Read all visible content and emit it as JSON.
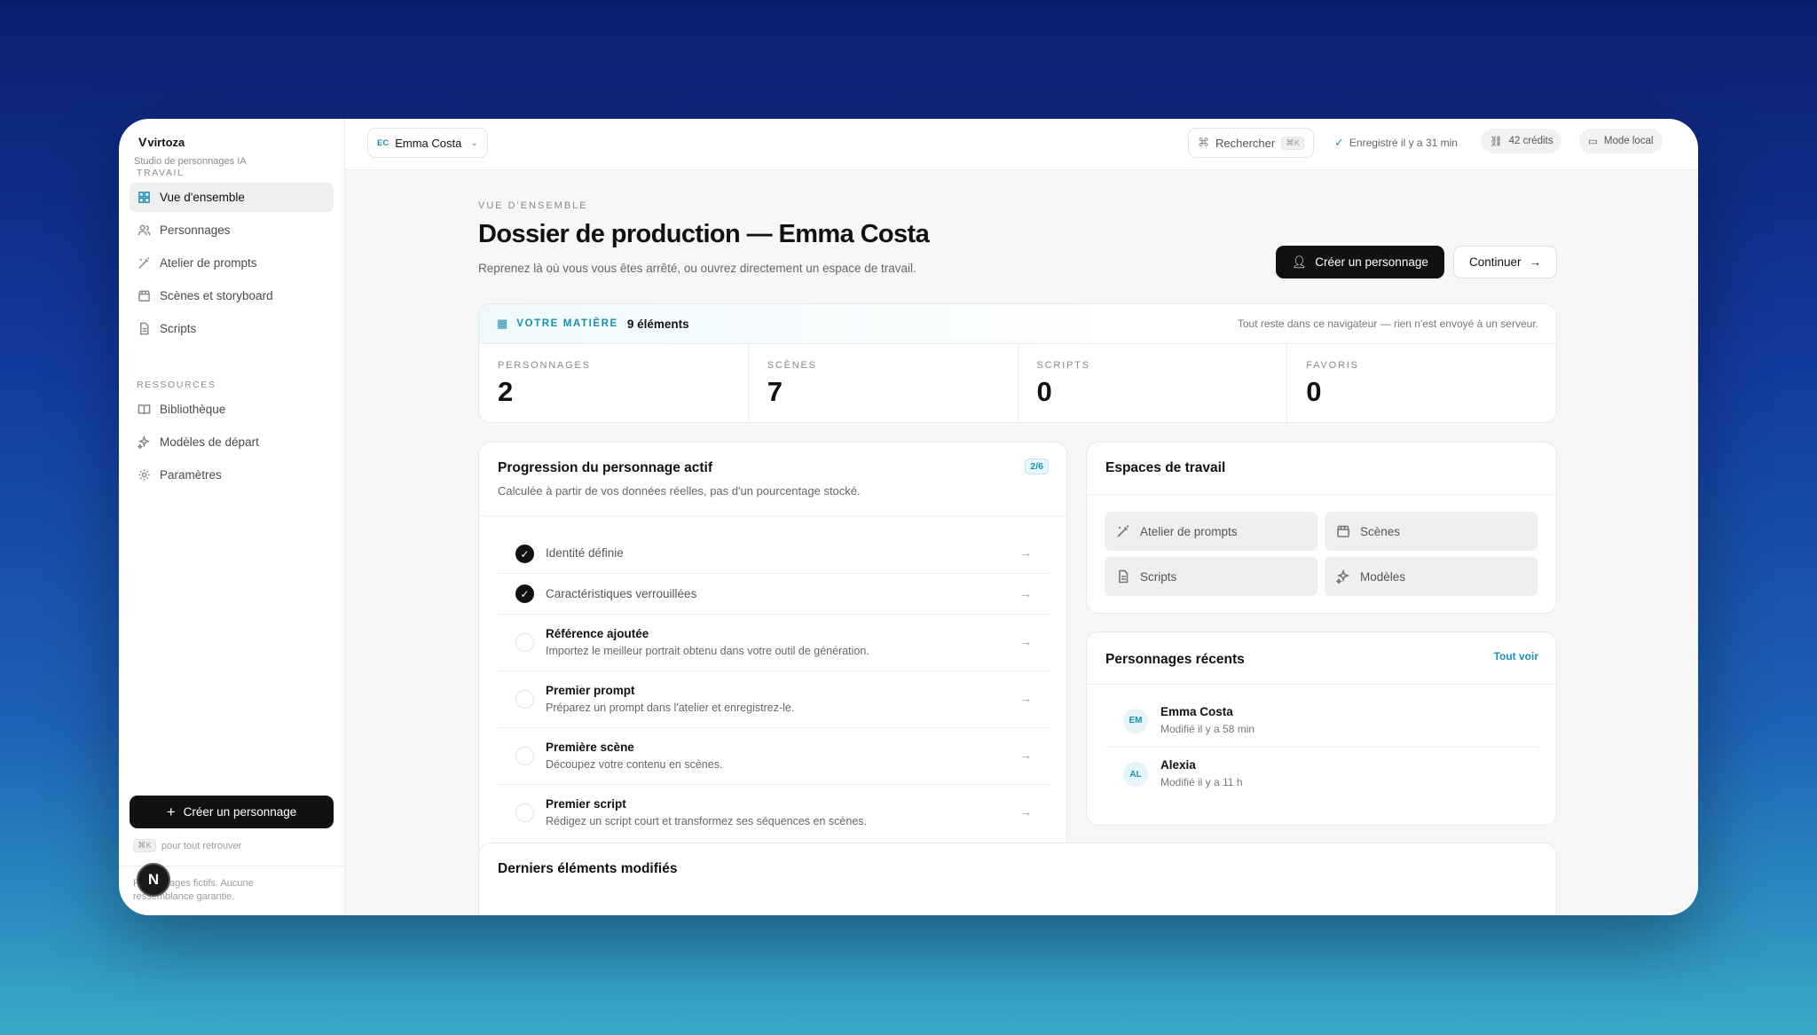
{
  "app": {
    "logo_text": "virtoza",
    "tagline": "Studio de personnages IA"
  },
  "sidebar": {
    "section_work": "TRAVAIL",
    "section_resources": "RESSOURCES",
    "work_items": [
      {
        "label": "Vue d'ensemble",
        "icon": "grid-icon",
        "active": true
      },
      {
        "label": "Personnages",
        "icon": "users-icon"
      },
      {
        "label": "Atelier de prompts",
        "icon": "wand-icon"
      },
      {
        "label": "Scènes et storyboard",
        "icon": "clapper-icon"
      },
      {
        "label": "Scripts",
        "icon": "document-icon"
      }
    ],
    "resource_items": [
      {
        "label": "Bibliothèque",
        "icon": "book-icon"
      },
      {
        "label": "Modèles de départ",
        "icon": "sparkles-icon"
      },
      {
        "label": "Paramètres",
        "icon": "gear-icon"
      }
    ],
    "create_button": "Créer un personnage",
    "shortcut_key": "⌘K",
    "shortcut_hint": "pour tout retrouver",
    "disclaimer": "Personnages fictifs. Aucune ressemblance garantie.",
    "fab_letter": "N"
  },
  "topbar": {
    "character_initials": "EC",
    "character_name": "Emma Costa",
    "search_label": "Rechercher",
    "search_shortcut": "⌘K",
    "save_status": "Enregistré il y a 31 min",
    "credits": "42 crédits",
    "mode": "Mode local"
  },
  "header": {
    "eyebrow": "VUE D'ENSEMBLE",
    "title": "Dossier de production — Emma Costa",
    "subtitle": "Reprenez là où vous vous êtes arrêté, ou ouvrez directement un espace de travail.",
    "primary_button": "Créer un personnage",
    "secondary_button": "Continuer"
  },
  "stats": {
    "label": "VOTRE MATIÈRE",
    "count": "9 éléments",
    "note": "Tout reste dans ce navigateur — rien n'est envoyé à un serveur.",
    "items": [
      {
        "key": "PERSONNAGES",
        "value": "2"
      },
      {
        "key": "SCÈNES",
        "value": "7"
      },
      {
        "key": "SCRIPTS",
        "value": "0"
      },
      {
        "key": "FAVORIS",
        "value": "0"
      }
    ]
  },
  "progress": {
    "title": "Progression du personnage actif",
    "badge": "2/6",
    "description": "Calculée à partir de vos données réelles, pas d'un pourcentage stocké.",
    "steps": [
      {
        "title": "Identité définie",
        "done": true,
        "detail": ""
      },
      {
        "title": "Caractéristiques verrouillées",
        "done": true,
        "detail": ""
      },
      {
        "title": "Référence ajoutée",
        "done": false,
        "detail": "Importez le meilleur portrait obtenu dans votre outil de génération."
      },
      {
        "title": "Premier prompt",
        "done": false,
        "detail": "Préparez un prompt dans l'atelier et enregistrez-le."
      },
      {
        "title": "Première scène",
        "done": false,
        "detail": "Découpez votre contenu en scènes."
      },
      {
        "title": "Premier script",
        "done": false,
        "detail": "Rédigez un script court et transformez ses séquences en scènes."
      }
    ]
  },
  "workspaces": {
    "title": "Espaces de travail",
    "items": [
      {
        "label": "Atelier de prompts",
        "icon": "wand-icon"
      },
      {
        "label": "Scènes",
        "icon": "clapper-icon"
      },
      {
        "label": "Scripts",
        "icon": "document-icon"
      },
      {
        "label": "Modèles",
        "icon": "sparkles-icon"
      }
    ]
  },
  "recent": {
    "title": "Personnages récents",
    "see_all": "Tout voir",
    "items": [
      {
        "initials": "EM",
        "name": "Emma Costa",
        "modified": "Modifié il y a 58 min"
      },
      {
        "initials": "AL",
        "name": "Alexia",
        "modified": "Modifié il y a 11 h"
      }
    ]
  },
  "last_modified": {
    "title": "Derniers éléments modifiés"
  },
  "colors": {
    "accent": "#1b8fb0",
    "dark": "#111111"
  }
}
